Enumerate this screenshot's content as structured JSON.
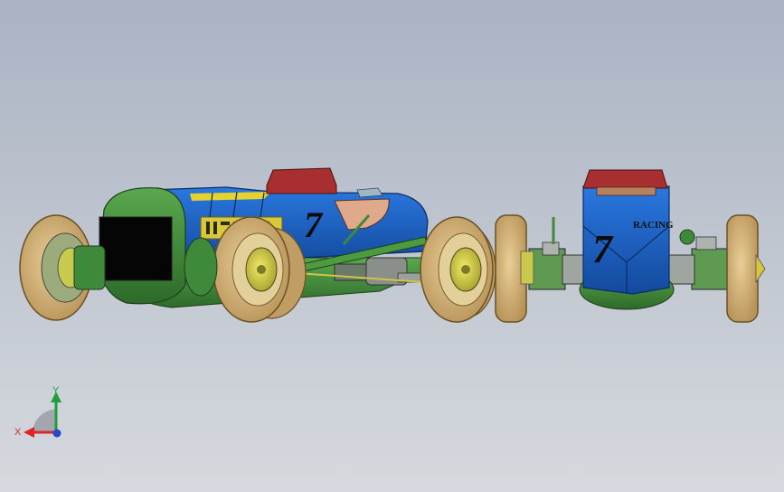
{
  "viewport": {
    "background_top": "#a9b3c3",
    "background_bottom": "#d6d9de"
  },
  "model": {
    "side_view": {
      "car_number": "7",
      "body_color": "#1e63c8",
      "chassis_color": "#3f8a3a",
      "tire_color": "#d9b77a",
      "seat_color": "#a82f2f"
    },
    "front_view": {
      "car_number": "7",
      "nose_text": "RACING"
    }
  },
  "triad": {
    "x_label": "X",
    "y_label": "Y",
    "icon": "coordinate-triad-icon",
    "x_color": "#d8262b",
    "y_color": "#1f9e3a",
    "z_color": "#2848c8"
  }
}
